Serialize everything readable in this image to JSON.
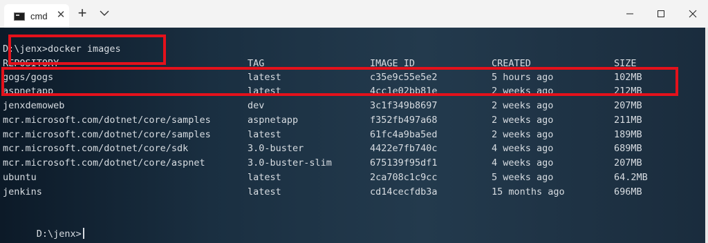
{
  "tab": {
    "title": "cmd",
    "icon": "terminal-icon",
    "close_glyph": "✕",
    "new_tab_glyph": "+"
  },
  "terminal": {
    "command_line": "D:\\jenx>docker images",
    "headers": [
      "REPOSITORY",
      "TAG",
      "IMAGE ID",
      "CREATED",
      "SIZE"
    ],
    "rows": [
      [
        "gogs/gogs",
        "latest",
        "c35e9c55e5e2",
        "5 hours ago",
        "102MB"
      ],
      [
        "aspnetapp",
        "latest",
        "4cc1e02bb81e",
        "2 weeks ago",
        "212MB"
      ],
      [
        "jenxdemoweb",
        "dev",
        "3c1f349b8697",
        "2 weeks ago",
        "207MB"
      ],
      [
        "mcr.microsoft.com/dotnet/core/samples",
        "aspnetapp",
        "f352fb497a68",
        "2 weeks ago",
        "211MB"
      ],
      [
        "mcr.microsoft.com/dotnet/core/samples",
        "latest",
        "61fc4a9ba5ed",
        "2 weeks ago",
        "189MB"
      ],
      [
        "mcr.microsoft.com/dotnet/core/sdk",
        "3.0-buster",
        "4422e7fb740c",
        "4 weeks ago",
        "689MB"
      ],
      [
        "mcr.microsoft.com/dotnet/core/aspnet",
        "3.0-buster-slim",
        "675139f95df1",
        "4 weeks ago",
        "207MB"
      ],
      [
        "ubuntu",
        "latest",
        "2ca708c1c9cc",
        "5 weeks ago",
        "64.2MB"
      ],
      [
        "jenkins",
        "latest",
        "cd14cecfdb3a",
        "15 months ago",
        "696MB"
      ]
    ],
    "prompt": "D:\\jenx>"
  },
  "colors": {
    "highlight": "#e4111b",
    "terminal_text": "#d8dde2",
    "terminal_bg": "#1a2f41"
  }
}
